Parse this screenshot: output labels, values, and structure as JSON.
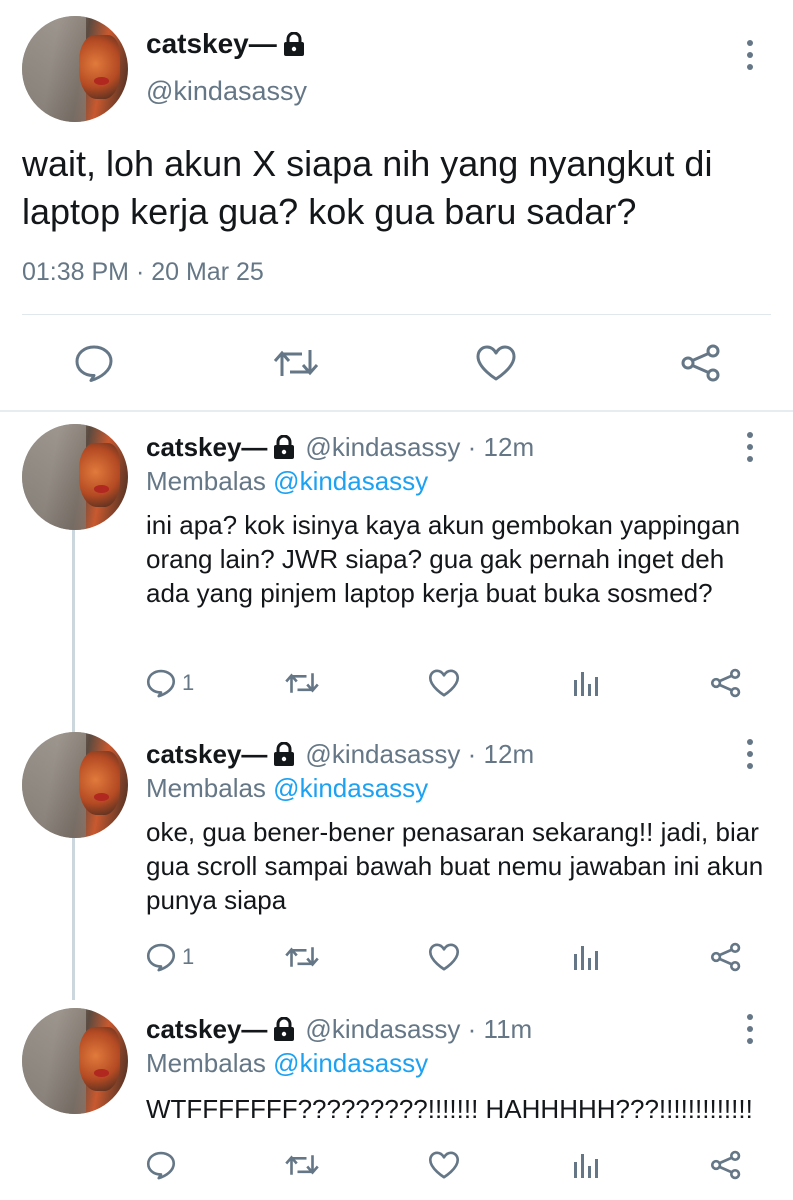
{
  "tweet": {
    "display_name": "catskey—",
    "handle": "@kindasassy",
    "text": "wait, loh akun X siapa nih yang nyangkut di laptop kerja gua? kok gua baru sadar?",
    "timestamp": "01:38 PM · 20 Mar 25",
    "lock_icon": "lock-icon",
    "actions": [
      "reply-icon",
      "retweet-icon",
      "like-icon",
      "share-icon"
    ]
  },
  "replies": [
    {
      "display_name": "catskey—",
      "meta": "@kindasassy · 12m",
      "reply_prefix": "Membalas",
      "reply_mention": "@kindasassy",
      "text": "ini apa? kok isinya kaya akun gembokan yappingan orang lain? JWR siapa? gua gak pernah inget deh ada yang pinjem laptop kerja buat buka sosmed?",
      "reply_count": "1"
    },
    {
      "display_name": "catskey—",
      "meta": "@kindasassy · 12m",
      "reply_prefix": "Membalas",
      "reply_mention": "@kindasassy",
      "text": "oke, gua bener-bener penasaran sekarang!! jadi, biar gua scroll sampai bawah buat nemu jawaban ini akun punya siapa",
      "reply_count": "1"
    },
    {
      "display_name": "catskey—",
      "meta": "@kindasassy · 11m",
      "reply_prefix": "Membalas",
      "reply_mention": "@kindasassy",
      "text": "WTFFFFFFF?????????!!!!!!! HAHHHHH???!!!!!!!!!!!!!",
      "reply_count": ""
    }
  ],
  "colors": {
    "text": "#14171a",
    "muted": "#657786",
    "mention": "#1da1f2",
    "divider": "#e1e8ed",
    "thread_line": "#ccd6dd"
  }
}
